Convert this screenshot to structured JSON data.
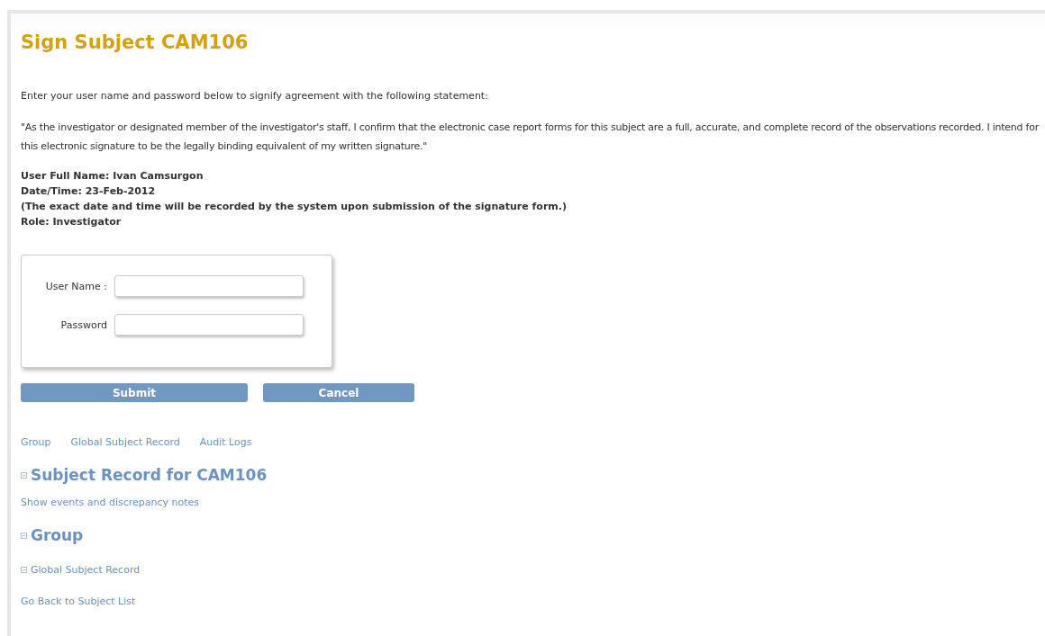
{
  "title": "Sign Subject CAM106",
  "intro": "Enter your user name and password below to signify agreement with the following statement:",
  "statement": "\"As the investigator or designated member of the investigator's staff, I confirm that the electronic case report forms for this subject are a full, accurate, and complete record of the observations recorded. I intend for this electronic signature to be the legally binding equivalent of my written signature.\"",
  "info_lines": [
    "User Full Name: Ivan Camsurgon",
    "Date/Time: 23-Feb-2012",
    "(The exact date and time will be recorded by the system upon submission of the signature form.)",
    "Role: Investigator"
  ],
  "form": {
    "fields": [
      {
        "label": "User Name :"
      },
      {
        "label": "Password"
      }
    ]
  },
  "buttons": [
    "Submit",
    "Cancel"
  ],
  "nav_links": [
    "Group",
    "Global Subject Record",
    "Audit Logs"
  ],
  "sections": [
    {
      "kind": "heading",
      "label": "Subject Record for CAM106"
    },
    {
      "kind": "link",
      "label": "Show events and discrepancy notes"
    },
    {
      "kind": "heading",
      "label": "Group"
    },
    {
      "kind": "subheading",
      "label": "Global Subject Record"
    },
    {
      "kind": "link",
      "label": "Go Back to Subject List"
    }
  ]
}
